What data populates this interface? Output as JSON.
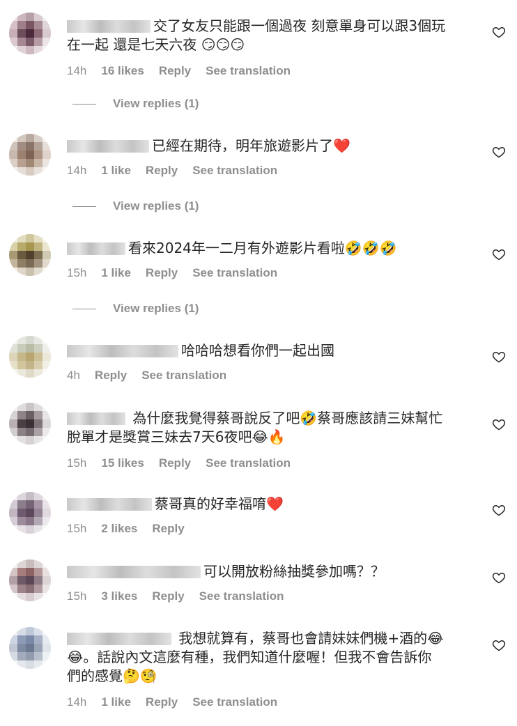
{
  "icons": {
    "like": "heart-outline-icon"
  },
  "colors": {
    "text": "#262626",
    "muted": "#8e8e8e",
    "background": "#ffffff"
  },
  "comments": [
    {
      "text_line1": "交了女友只能跟一個過夜 刻意單身可以跟3個玩",
      "text_line2": "在一起 還是七天六夜 😏😏😏",
      "time": "14h",
      "likes": "16 likes",
      "reply": "Reply",
      "translate": "See translation",
      "view_replies": "View replies (1)"
    },
    {
      "text_line1": "已經在期待，明年旅遊影片了❤️",
      "time": "14h",
      "likes": "1 like",
      "reply": "Reply",
      "translate": "See translation",
      "view_replies": "View replies (1)"
    },
    {
      "text_line1": "看來2024年一二月有外遊影片看啦🤣🤣🤣",
      "time": "15h",
      "likes": "1 like",
      "reply": "Reply",
      "translate": "See translation",
      "view_replies": "View replies (1)"
    },
    {
      "text_line1": "哈哈哈想看你們一起出國",
      "time": "4h",
      "reply": "Reply",
      "translate": "See translation"
    },
    {
      "text_line1": "為什麼我覺得蔡哥說反了吧🤣蔡哥應該請三妹幫忙",
      "text_line2": "脫單才是獎賞三妹去7天6夜吧😂🔥",
      "time": "15h",
      "likes": "15 likes",
      "reply": "Reply",
      "translate": "See translation"
    },
    {
      "text_line1": "蔡哥真的好幸福唷❤️",
      "time": "15h",
      "likes": "2 likes",
      "reply": "Reply"
    },
    {
      "text_line1": "可以開放粉絲抽獎參加嗎？？",
      "time": "15h",
      "likes": "3 likes",
      "reply": "Reply",
      "translate": "See translation"
    },
    {
      "text_line1": "我想就算有，蔡哥也會請妹妹們機+酒的😂",
      "text_line2": "😂。話說內文這麼有種，我們知道什麼喔！但我不會告訴你",
      "text_line3": "們的感覺🤔🧐",
      "time": "14h",
      "likes": "1 like",
      "reply": "Reply",
      "translate": "See translation"
    }
  ]
}
